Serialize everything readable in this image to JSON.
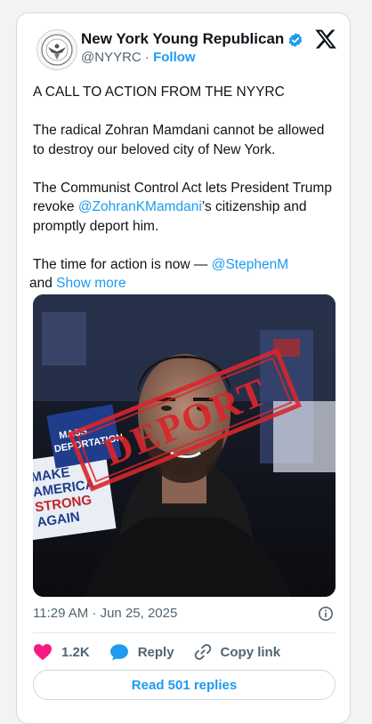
{
  "author": {
    "display_name": "New York Young Republican ...",
    "handle": "@NYYRC",
    "separator": "·",
    "follow_label": "Follow"
  },
  "tweet": {
    "line1": "A CALL TO ACTION FROM THE NYYRC",
    "line2": "The radical Zohran Mamdani cannot be allowed to destroy our beloved city of New York.",
    "line3_a": "The Communist Control Act lets President Trump revoke ",
    "line3_mention": "@ZohranKMamdani",
    "line3_b": "’s citizenship and promptly deport him.",
    "line4_a": "The time for action is now — ",
    "line4_mention": "@StephenM",
    "line4_b": " and ",
    "show_more": "Show more"
  },
  "media": {
    "stamp_text": "DEPORT",
    "sign_text_1": "MAKE",
    "sign_text_2": "AMERICA",
    "sign_text_3": "STRONG",
    "sign_text_4": "AGAIN",
    "sign_text_5": "MASS",
    "sign_text_6": "DEPORTATION",
    "colors": {
      "stamp": "#d9262b"
    }
  },
  "meta": {
    "timestamp": "11:29 AM · Jun 25, 2025"
  },
  "actions": {
    "likes": "1.2K",
    "reply": "Reply",
    "copy_link": "Copy link"
  },
  "replies_button": "Read 501 replies",
  "colors": {
    "accent": "#1d9bf0",
    "like": "#f91880",
    "text": "#0f1419",
    "muted": "#536471"
  }
}
